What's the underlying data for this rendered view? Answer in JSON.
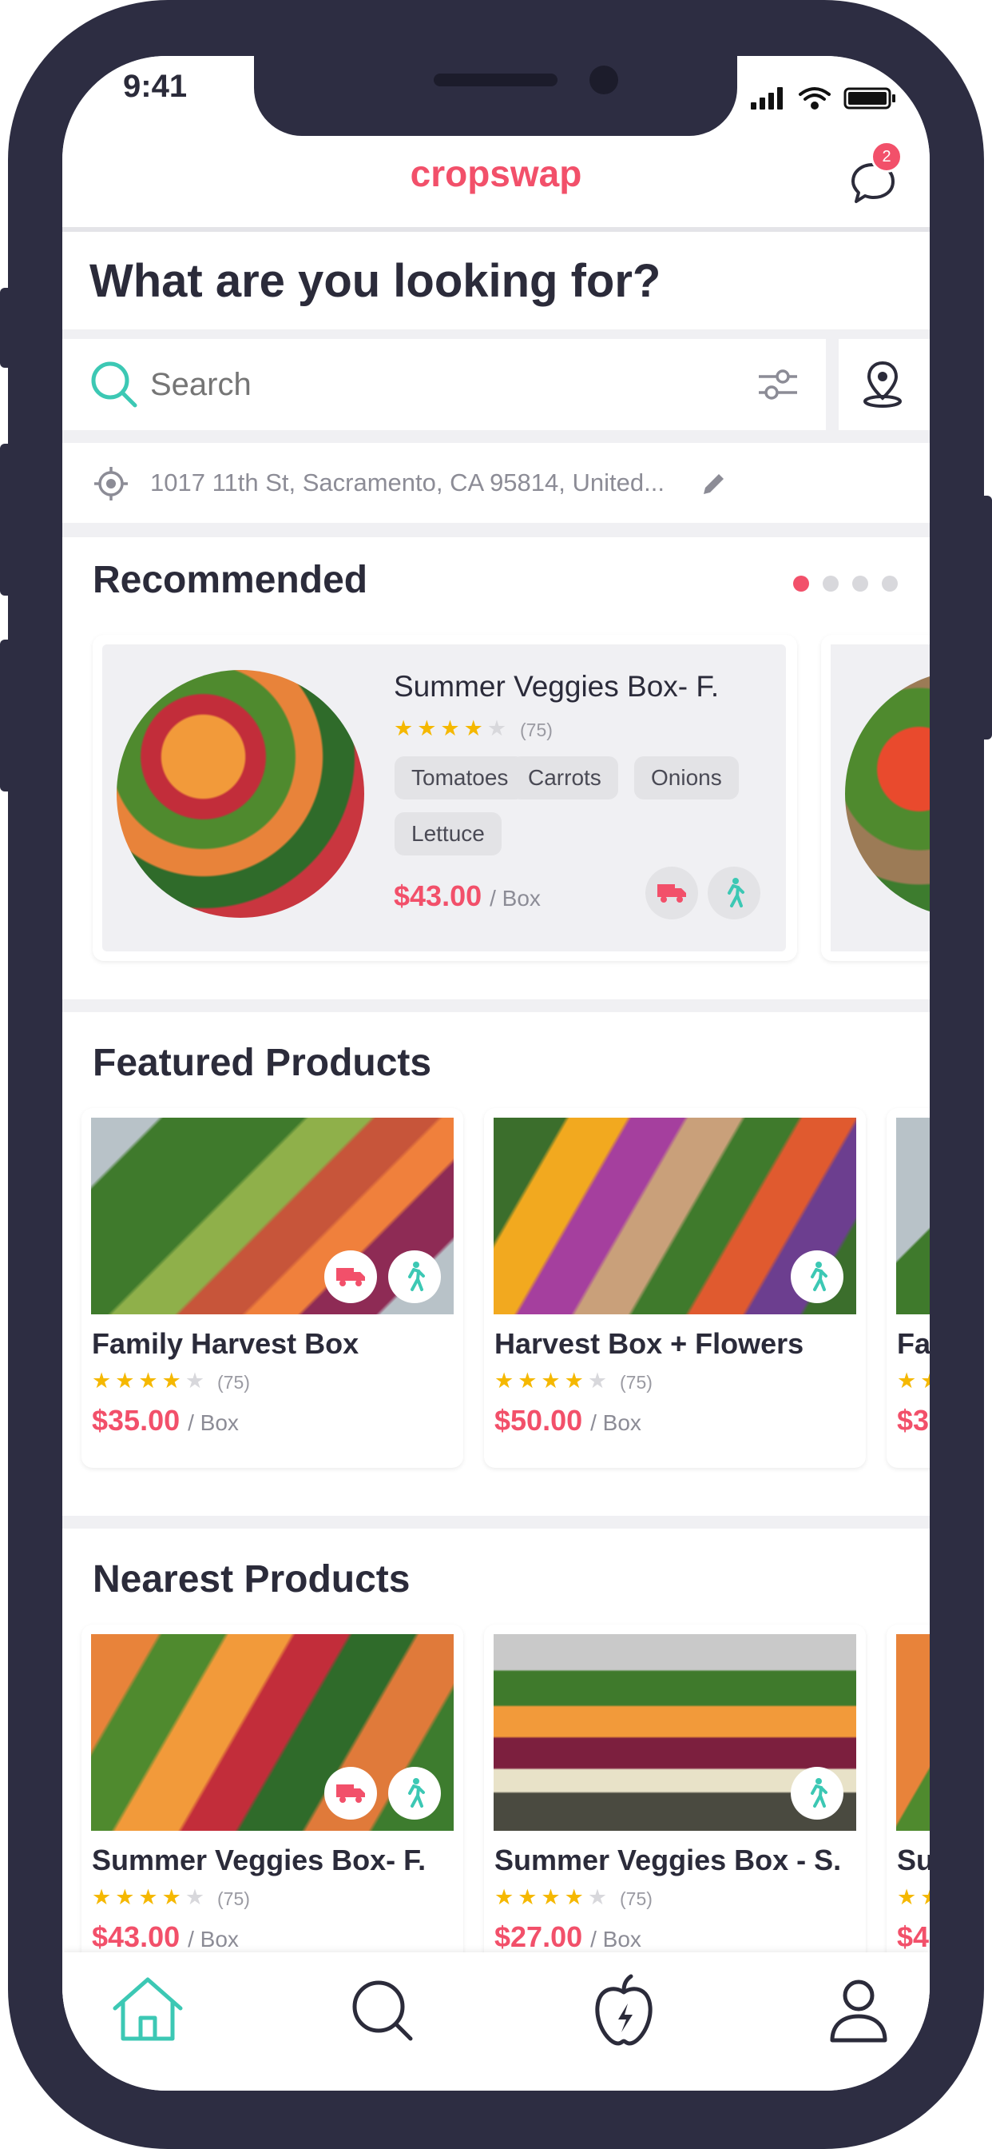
{
  "status_bar": {
    "time": "9:41"
  },
  "header": {
    "brand": "cropswap",
    "notification_count": "2"
  },
  "hero": {
    "title": "What are you looking for?"
  },
  "search": {
    "placeholder": "Search"
  },
  "location": {
    "address": "1017 11th St, Sacramento, CA 95814, United..."
  },
  "recommended": {
    "title": "Recommended",
    "pages": 4,
    "active_page": 1,
    "card": {
      "title": "Summer Veggies Box- F.",
      "rating_stars": 4,
      "rating_count": "(75)",
      "tags": [
        "Tomatoes",
        "Carrots",
        "Onions",
        "Lettuce"
      ],
      "price": "$43.00",
      "unit": "/ Box"
    }
  },
  "featured": {
    "title": "Featured Products",
    "items": [
      {
        "title": "Family Harvest Box",
        "rating_stars": 4,
        "rating_count": "(75)",
        "price": "$35.00",
        "unit": "/ Box"
      },
      {
        "title": "Harvest Box + Flowers",
        "rating_stars": 4,
        "rating_count": "(75)",
        "price": "$50.00",
        "unit": "/ Box"
      },
      {
        "title": "Fa",
        "price": "$3"
      }
    ]
  },
  "nearest": {
    "title": "Nearest Products",
    "items": [
      {
        "title": "Summer Veggies Box- F.",
        "rating_stars": 4,
        "rating_count": "(75)",
        "price": "$43.00",
        "unit": "/ Box"
      },
      {
        "title": "Summer Veggies Box - S.",
        "rating_stars": 4,
        "rating_count": "(75)",
        "price": "$27.00",
        "unit": "/ Box"
      },
      {
        "title": "Su",
        "price": "$4"
      }
    ]
  },
  "tab_bar": {
    "items": [
      {
        "icon": "home-icon",
        "active": true
      },
      {
        "icon": "search-icon",
        "active": false
      },
      {
        "icon": "apple-bolt-icon",
        "active": false
      },
      {
        "icon": "profile-icon",
        "active": false
      }
    ]
  },
  "colors": {
    "accent": "#f2506a",
    "teal": "#3cc8b4",
    "dark": "#2b2b3a",
    "frame": "#2d2d42"
  }
}
